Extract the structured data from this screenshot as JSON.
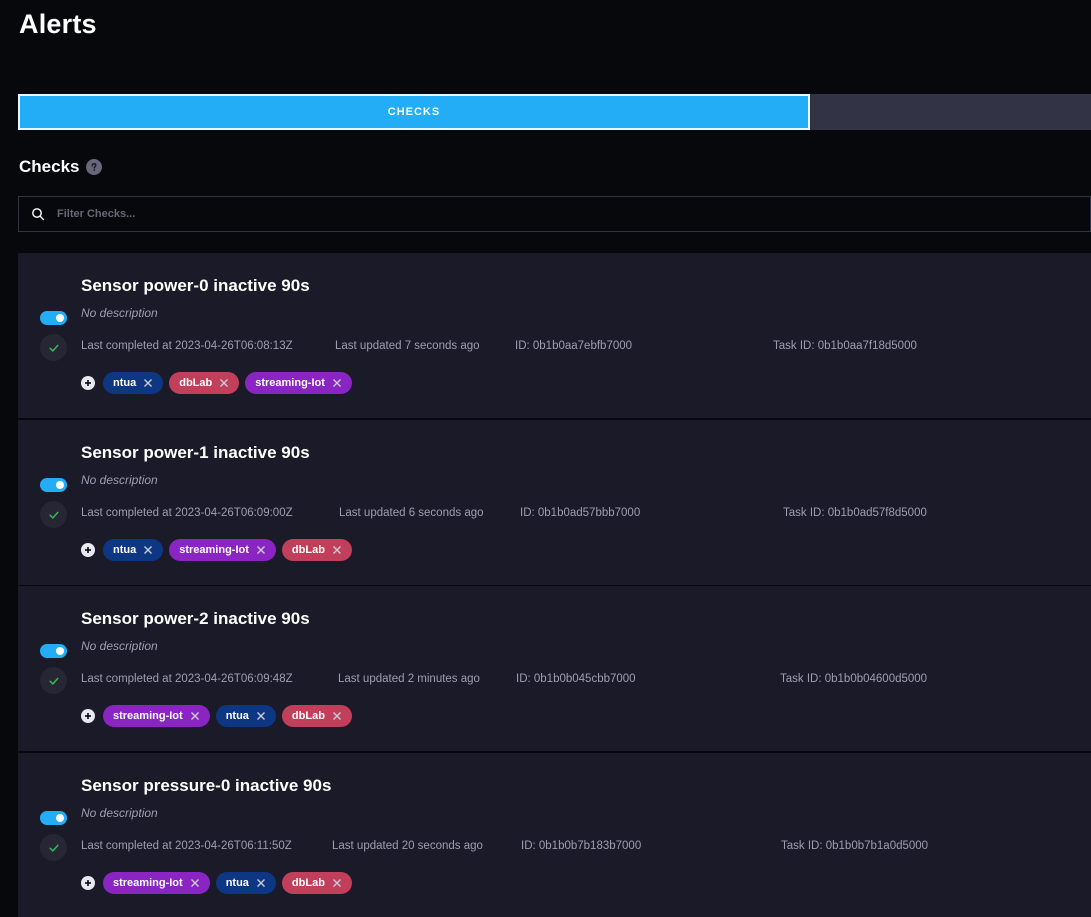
{
  "page": {
    "title": "Alerts"
  },
  "tabs": [
    {
      "label": "CHECKS",
      "active": true
    },
    {
      "label": "",
      "active": false
    }
  ],
  "checks_section": {
    "title": "Checks",
    "filter_placeholder": "Filter Checks..."
  },
  "colors": {
    "accent": "#22adf6",
    "card_bg": "#1a1a28",
    "label_ntua": "#0d3782",
    "label_dblab": "#c13f5a",
    "label_streaming": "#8a25c4",
    "success": "#34bb55"
  },
  "icons": {
    "search": "search-icon",
    "help": "help-icon",
    "status": "check-icon",
    "add_label": "plus-icon",
    "remove_label": "close-icon"
  },
  "checks": [
    {
      "name": "Sensor power-0 inactive 90s",
      "description": "No description",
      "enabled": true,
      "last_completed": "Last completed at 2023-04-26T06:08:13Z",
      "last_updated": "Last updated 7 seconds ago",
      "id": "ID: 0b1b0aa7ebfb7000",
      "task_id": "Task ID: 0b1b0aa7f18d5000",
      "labels": [
        {
          "text": "ntua",
          "color": "#0d3782"
        },
        {
          "text": "dbLab",
          "color": "#c13f5a"
        },
        {
          "text": "streaming-Iot",
          "color": "#8a25c4"
        }
      ]
    },
    {
      "name": "Sensor power-1 inactive 90s",
      "description": "No description",
      "enabled": true,
      "last_completed": "Last completed at 2023-04-26T06:09:00Z",
      "last_updated": "Last updated 6 seconds ago",
      "id": "ID: 0b1b0ad57bbb7000",
      "task_id": "Task ID: 0b1b0ad57f8d5000",
      "labels": [
        {
          "text": "ntua",
          "color": "#0d3782"
        },
        {
          "text": "streaming-Iot",
          "color": "#8a25c4"
        },
        {
          "text": "dbLab",
          "color": "#c13f5a"
        }
      ]
    },
    {
      "name": "Sensor power-2 inactive 90s",
      "description": "No description",
      "enabled": true,
      "last_completed": "Last completed at 2023-04-26T06:09:48Z",
      "last_updated": "Last updated 2 minutes ago",
      "id": "ID: 0b1b0b045cbb7000",
      "task_id": "Task ID: 0b1b0b04600d5000",
      "labels": [
        {
          "text": "streaming-Iot",
          "color": "#8a25c4"
        },
        {
          "text": "ntua",
          "color": "#0d3782"
        },
        {
          "text": "dbLab",
          "color": "#c13f5a"
        }
      ]
    },
    {
      "name": "Sensor pressure-0 inactive 90s",
      "description": "No description",
      "enabled": true,
      "last_completed": "Last completed at 2023-04-26T06:11:50Z",
      "last_updated": "Last updated 20 seconds ago",
      "id": "ID: 0b1b0b7b183b7000",
      "task_id": "Task ID: 0b1b0b7b1a0d5000",
      "labels": [
        {
          "text": "streaming-Iot",
          "color": "#8a25c4"
        },
        {
          "text": "ntua",
          "color": "#0d3782"
        },
        {
          "text": "dbLab",
          "color": "#c13f5a"
        }
      ]
    }
  ]
}
